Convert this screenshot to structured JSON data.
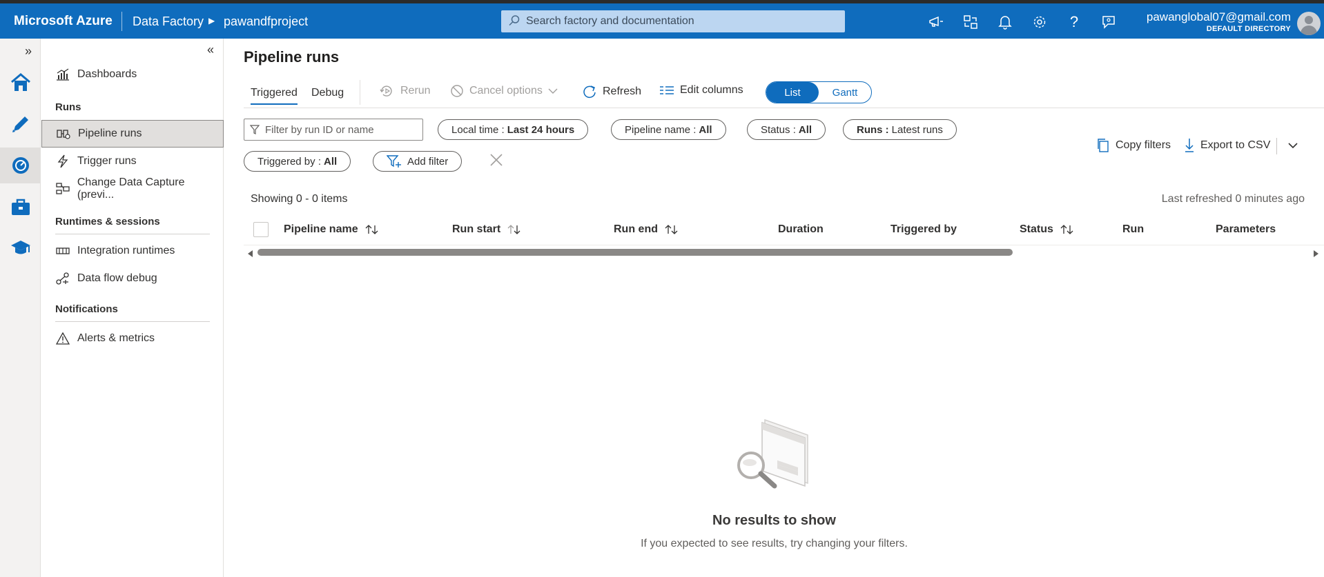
{
  "header": {
    "brand": "Microsoft Azure",
    "crumb_service": "Data Factory",
    "crumb_factory": "pawandfproject",
    "search_placeholder": "Search factory and documentation",
    "icons": [
      "announcement-icon",
      "switch-icon",
      "notification-bell-icon",
      "settings-gear-icon",
      "help-icon",
      "feedback-icon"
    ],
    "account_email": "pawanglobal07@gmail.com",
    "account_directory": "DEFAULT DIRECTORY"
  },
  "rail": {
    "items": [
      "home-icon",
      "author-pencil-icon",
      "monitor-icon",
      "manage-toolbox-icon",
      "learning-cap-icon"
    ],
    "active": "monitor-icon"
  },
  "sidenav": {
    "dashboards": "Dashboards",
    "runs_heading": "Runs",
    "pipeline_runs": "Pipeline runs",
    "trigger_runs": "Trigger runs",
    "change_data_capture": "Change Data Capture (previ...",
    "runtimes_heading": "Runtimes & sessions",
    "integration_runtimes": "Integration runtimes",
    "data_flow_debug": "Data flow debug",
    "notifications_heading": "Notifications",
    "alerts_metrics": "Alerts & metrics"
  },
  "main": {
    "title": "Pipeline runs",
    "tabs": {
      "triggered": "Triggered",
      "debug": "Debug"
    },
    "toolbar": {
      "rerun": "Rerun",
      "cancel_options": "Cancel options",
      "refresh": "Refresh",
      "edit_columns": "Edit columns",
      "view_list": "List",
      "view_gantt": "Gantt"
    },
    "filters": {
      "search_placeholder": "Filter by run ID or name",
      "local_time_label": "Local time :",
      "local_time_value": "Last 24 hours",
      "pipeline_name_label": "Pipeline name :",
      "pipeline_name_value": "All",
      "status_label": "Status :",
      "status_value": "All",
      "runs_label": "Runs :",
      "runs_value": "Latest runs",
      "triggered_by_label": "Triggered by :",
      "triggered_by_value": "All",
      "add_filter": "Add filter",
      "copy_filters": "Copy filters",
      "export_csv": "Export to CSV"
    },
    "showing": "Showing 0 - 0 items",
    "last_refreshed": "Last refreshed 0 minutes ago",
    "columns": {
      "pipeline_name": "Pipeline name",
      "run_start": "Run start",
      "run_end": "Run end",
      "duration": "Duration",
      "triggered_by": "Triggered by",
      "status": "Status",
      "run": "Run",
      "parameters": "Parameters"
    },
    "empty": {
      "title": "No results to show",
      "subtitle": "If you expected to see results, try changing your filters."
    }
  },
  "colors": {
    "brand_blue": "#0f6cbd",
    "search_bg": "#bcd6f1",
    "selected_bg": "#e1dfdd"
  }
}
